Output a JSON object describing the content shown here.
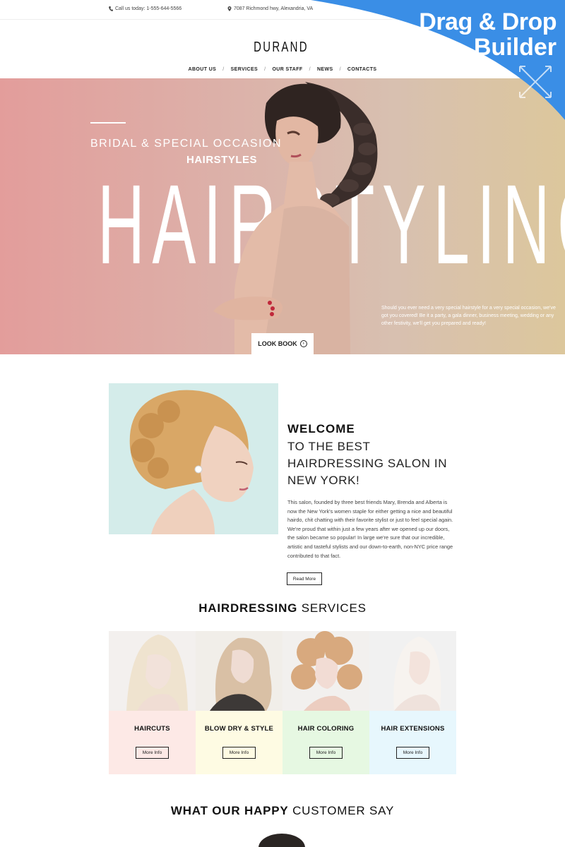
{
  "topbar": {
    "phone": "Call us today: 1-555-644-5566",
    "address": "7087 Richmond hwy, Alexandria, VA"
  },
  "brand": {
    "logo": "DURAND"
  },
  "nav": {
    "items": [
      "ABOUT US",
      "SERVICES",
      "OUR STAFF",
      "NEWS",
      "CONTACTS"
    ],
    "separator": "/"
  },
  "badge": {
    "line1": "Drag & Drop",
    "line2": "Builder"
  },
  "hero": {
    "subtitle1": "BRIDAL & SPECIAL OCCASION",
    "subtitle2": "HAIRSTYLES",
    "headline": "HAIRSTYLING",
    "description": "Should you ever need a very special hairstyle for a very special occasion, we've got you covered! Be it a party, a gala dinner, business meeting, wedding or any other festivity, we'll get you prepared and ready!",
    "button": "LOOK BOOK"
  },
  "welcome": {
    "title": "WELCOME",
    "subtitle": "TO THE BEST HAIRDRESSING SALON IN NEW YORK!",
    "paragraph": "This salon, founded by three best friends Mary, Brenda and Alberta is now the New York's women staple for either getting a nice and beautiful hairdo, chit chatting with their favorite stylist or just to feel special again. We're proud that within just a few years after we opened up our doors, the salon became so popular! In large we're sure that our incredible, artistic and tasteful stylists and our down-to-earth, non-NYC price range contributed to that fact.",
    "button": "Read More"
  },
  "services": {
    "title_bold": "HAIRDRESSING",
    "title_rest": " SERVICES",
    "items": [
      {
        "name": "HAIRCUTS",
        "button": "More Info",
        "color": "#fde9e6"
      },
      {
        "name": "BLOW DRY & STYLE",
        "button": "More Info",
        "color": "#fefbe3"
      },
      {
        "name": "HAIR COLORING",
        "button": "More Info",
        "color": "#e6f8e2"
      },
      {
        "name": "HAIR EXTENSIONS",
        "button": "More Info",
        "color": "#e7f7fd"
      }
    ]
  },
  "testimonials": {
    "title_bold": "WHAT OUR HAPPY",
    "title_rest": " CUSTOMER SAY"
  }
}
